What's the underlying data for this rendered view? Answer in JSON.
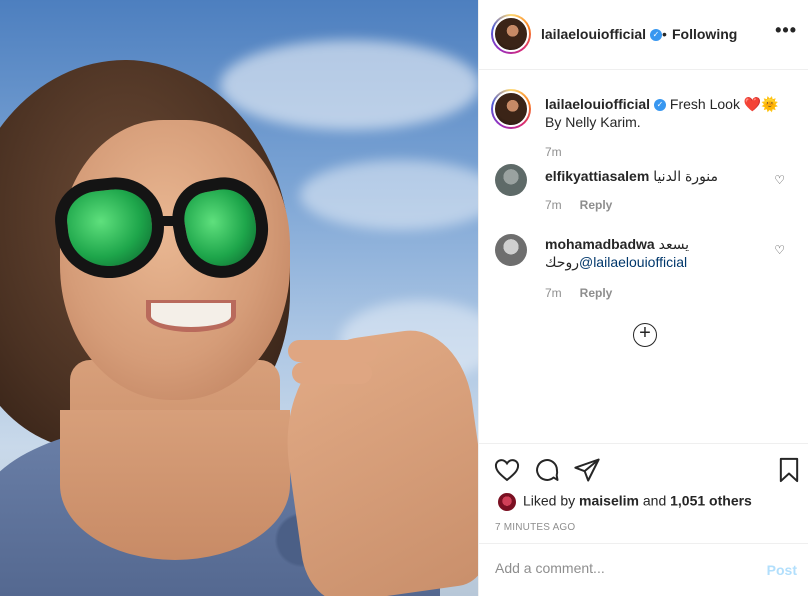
{
  "post": {
    "username": "lailaelouiofficial",
    "separator": "•",
    "follow_status": "Following",
    "more_icon": "more-options-icon"
  },
  "caption": {
    "username": "lailaelouiofficial",
    "text": "Fresh Look ❤️🌞",
    "text_line2": "By Nelly Karim.",
    "age": "7m"
  },
  "comments": [
    {
      "username": "elfikyattiasalem",
      "text": "منورة الدنيا",
      "age": "7m",
      "reply_label": "Reply"
    },
    {
      "username": "mohamadbadwa",
      "text": "يسعد",
      "mention": "@lailaelouiofficial",
      "text_after": "روحك",
      "age": "7m",
      "reply_label": "Reply"
    }
  ],
  "load_more_icon": "plus-circle-icon",
  "actions": {
    "like_icon": "heart-icon",
    "comment_icon": "comment-icon",
    "share_icon": "share-icon",
    "save_icon": "bookmark-icon"
  },
  "likes": {
    "prefix": "Liked by",
    "user": "maiselim",
    "connector": "and",
    "others": "1,051 others"
  },
  "time_ago": "7 MINUTES AGO",
  "add_comment": {
    "placeholder": "Add a comment...",
    "post_label": "Post"
  },
  "colors": {
    "verified": "#3897f0",
    "post_button_disabled": "#b2dffc",
    "mention": "#00376b"
  }
}
